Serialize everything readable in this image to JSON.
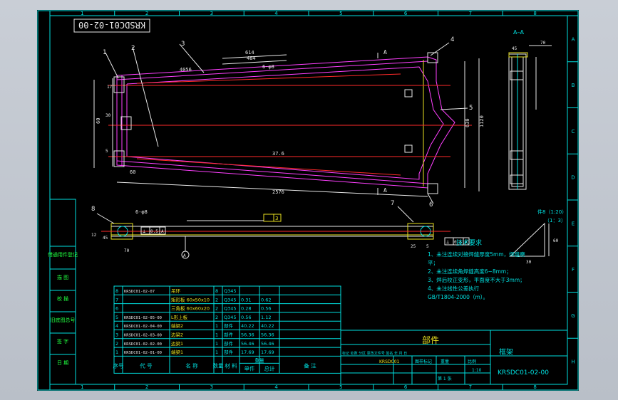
{
  "drawing_number_rotated": "KRSDC01-02-00",
  "grid": {
    "cols": [
      "1",
      "2",
      "3",
      "4",
      "5",
      "6",
      "7",
      "8"
    ],
    "rows": [
      "A",
      "B",
      "C",
      "D",
      "E",
      "F",
      "G",
      "H"
    ]
  },
  "main_view": {
    "dims": {
      "d614": "614",
      "d484": "484",
      "d6_68": "6-φ8",
      "d4056": "4056",
      "d2576": "2576",
      "d60": "60",
      "d630": "630",
      "d1120": "1120",
      "d37_6": "37.6",
      "d30": "30",
      "d5": "5",
      "d17": "17",
      "d60b": "60"
    },
    "callouts": [
      "1",
      "2",
      "3",
      "4",
      "5",
      "6"
    ],
    "section_mark": "A"
  },
  "section_view": {
    "title": "A–A",
    "dims": {
      "d45": "45",
      "d70": "70"
    }
  },
  "front_view": {
    "callouts": [
      "8",
      "7"
    ],
    "dims": {
      "d6_8": "6-φ8",
      "d45": "45",
      "d70": "70",
      "d12": "12",
      "d25": "25",
      "d5": "5"
    },
    "weld_box": "3",
    "tolerance_left": [
      "⊥",
      "0.5",
      "A"
    ],
    "tolerance_right": [
      "⊥",
      "0.5",
      "A"
    ],
    "datum": "A"
  },
  "detail": {
    "title": "件8（1:20）",
    "scale": "（1：3）",
    "dims": {
      "d60": "60",
      "d30": "30"
    }
  },
  "tech_requirements": {
    "title": "技术要求",
    "lines": [
      "1、未注连续对接焊缝厚度5mm，焊缝磨",
      "平；",
      "2、未注连续角焊缝高度6~8mm；",
      "3、焊后校正变形，平面度不大于3mm；",
      "4、未注线性公差执行",
      "GB/T1804-2000（m）。"
    ]
  },
  "left_side_labels": [
    "借通用件登记",
    "描  图",
    "校  描",
    "旧底图总号",
    "签  字",
    "日  期"
  ],
  "bom": {
    "headers": [
      "序号",
      "代  号",
      "名  称",
      "数量",
      "材  料",
      "单件",
      "总计",
      "备  注"
    ],
    "weight_header": "重量",
    "rows": [
      [
        "8",
        "KRSDC01-02-07",
        "吊环",
        "8",
        "Q345",
        "",
        "",
        ""
      ],
      [
        "7",
        "",
        "矩形板 60x50x10",
        "2",
        "Q345",
        "0.31",
        "0.62",
        ""
      ],
      [
        "6",
        "",
        "三角板 60x60x20",
        "2",
        "Q345",
        "0.28",
        "0.56",
        ""
      ],
      [
        "5",
        "KRSDC01-02-05-00",
        "L形上板",
        "2",
        "Q345",
        "0.56",
        "1.12",
        ""
      ],
      [
        "4",
        "KRSDC01-02-04-00",
        "端梁2",
        "1",
        "部件",
        "40.22",
        "40.22",
        ""
      ],
      [
        "3",
        "KRSDC01-02-03-00",
        "边梁2",
        "1",
        "部件",
        "56.36",
        "56.36",
        ""
      ],
      [
        "2",
        "KRSDC01-02-02-00",
        "边梁1",
        "1",
        "部件",
        "56.46",
        "56.46",
        ""
      ],
      [
        "1",
        "KRSDC01-02-01-00",
        "端梁1",
        "1",
        "部件",
        "17.69",
        "17.69",
        ""
      ]
    ]
  },
  "title_block": {
    "part_type": "部件",
    "name": "框架",
    "drawing_no": "KRSDC01-02-00",
    "scale": "1:10",
    "sheet": "第 1 张",
    "stage_labels": [
      "图样标记",
      "重量",
      "比例"
    ],
    "header_row": "标记 处数 分区 更改文件号 签名 年 月 日",
    "code": "KRSDC01"
  }
}
